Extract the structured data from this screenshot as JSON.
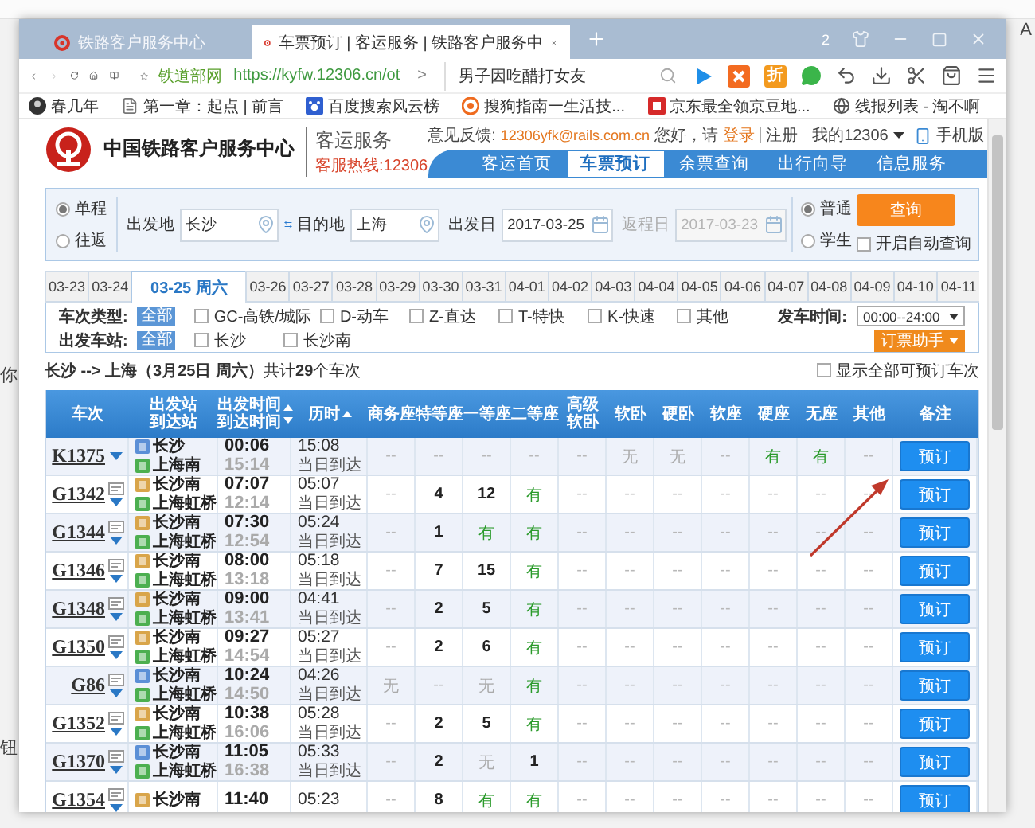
{
  "desktop": {
    "fragments": [
      "A",
      "你",
      "钮"
    ]
  },
  "browser": {
    "tabs": [
      {
        "title": "铁路客户服务中心",
        "selected": false
      },
      {
        "title": "车票预订 | 客运服务 | 铁路客户服务中",
        "selected": true
      }
    ],
    "badge": "2",
    "site_label": "铁道部网",
    "url": "https://kyfw.12306.cn/ot",
    "url_more": ">",
    "search_value": "男子因吃醋打女友",
    "discount_label": "折",
    "bookmarks": [
      {
        "label": "春几年",
        "kind": "avatar"
      },
      {
        "label": "第一章：起点 | 前言",
        "kind": "page"
      },
      {
        "label": "百度搜索风云榜",
        "kind": "paw"
      },
      {
        "label": "搜狗指南一生活技...",
        "kind": "sogou"
      },
      {
        "label": "京东最全领京豆地...",
        "kind": "jd"
      },
      {
        "label": "线报列表 - 淘不啊",
        "kind": "globe"
      }
    ]
  },
  "header": {
    "title": "中国铁路客户服务中心",
    "subtitle": "客运服务",
    "hotline": "客服热线:12306",
    "feedback_label": "意见反馈:",
    "feedback_email": "12306yfk@rails.com.cn",
    "greeting": "您好，请",
    "login": "登录",
    "register": "注册",
    "account": "我的12306",
    "mobile": "手机版",
    "nav": [
      {
        "label": "客运首页",
        "selected": false
      },
      {
        "label": "车票预订",
        "selected": true
      },
      {
        "label": "余票查询",
        "selected": false
      },
      {
        "label": "出行向导",
        "selected": false
      },
      {
        "label": "信息服务",
        "selected": false
      }
    ]
  },
  "search_form": {
    "trip_types": [
      {
        "label": "单程",
        "selected": true
      },
      {
        "label": "往返",
        "selected": false
      }
    ],
    "from": {
      "label": "出发地",
      "value": "长沙"
    },
    "to": {
      "label": "目的地",
      "value": "上海"
    },
    "depart_date": {
      "label": "出发日",
      "value": "2017-03-25",
      "disabled": false
    },
    "return_date": {
      "label": "返程日",
      "value": "2017-03-23",
      "disabled": true
    },
    "passenger_types": [
      {
        "label": "普通",
        "selected": true
      },
      {
        "label": "学生",
        "selected": false
      }
    ],
    "query_button": "查询",
    "auto_query": {
      "label": "开启自动查询",
      "checked": false
    }
  },
  "date_tabs": [
    {
      "label": "03-23",
      "selected": false
    },
    {
      "label": "03-24",
      "selected": false
    },
    {
      "label": "03-25 周六",
      "selected": true
    },
    {
      "label": "03-26",
      "selected": false
    },
    {
      "label": "03-27",
      "selected": false
    },
    {
      "label": "03-28",
      "selected": false
    },
    {
      "label": "03-29",
      "selected": false
    },
    {
      "label": "03-30",
      "selected": false
    },
    {
      "label": "03-31",
      "selected": false
    },
    {
      "label": "04-01",
      "selected": false
    },
    {
      "label": "04-02",
      "selected": false
    },
    {
      "label": "04-03",
      "selected": false
    },
    {
      "label": "04-04",
      "selected": false
    },
    {
      "label": "04-05",
      "selected": false
    },
    {
      "label": "04-06",
      "selected": false
    },
    {
      "label": "04-07",
      "selected": false
    },
    {
      "label": "04-08",
      "selected": false
    },
    {
      "label": "04-09",
      "selected": false
    },
    {
      "label": "04-10",
      "selected": false
    },
    {
      "label": "04-11",
      "selected": false
    }
  ],
  "filters": {
    "train_types": {
      "label": "车次类型:",
      "all": {
        "label": "全部",
        "selected": true
      },
      "options": [
        {
          "label": "GC-高铁/城际",
          "checked": false
        },
        {
          "label": "D-动车",
          "checked": false
        },
        {
          "label": "Z-直达",
          "checked": false
        },
        {
          "label": "T-特快",
          "checked": false
        },
        {
          "label": "K-快速",
          "checked": false
        },
        {
          "label": "其他",
          "checked": false
        }
      ]
    },
    "stations": {
      "label": "出发车站:",
      "all": {
        "label": "全部",
        "selected": true
      },
      "options": [
        {
          "label": "长沙",
          "checked": false
        },
        {
          "label": "长沙南",
          "checked": false
        }
      ]
    },
    "time_label": "发车时间:",
    "time_value": "00:00--24:00",
    "helper_button": "订票助手"
  },
  "summary": {
    "text": "**长沙 --> 上海（3月25日  周六）**共计**29**个车次",
    "show_all": {
      "label": "显示全部可预订车次",
      "checked": false
    }
  },
  "table": {
    "columns": [
      {
        "lines": [
          "车次"
        ]
      },
      {
        "lines": [
          "出发站",
          "到达站"
        ]
      },
      {
        "lines": [
          "出发时间",
          "到达时间"
        ],
        "sort_up": true,
        "sort_down": true
      },
      {
        "lines": [
          "历时"
        ],
        "sort_up": true
      },
      {
        "lines": [
          "商务座"
        ]
      },
      {
        "lines": [
          "特等座"
        ]
      },
      {
        "lines": [
          "一等座"
        ]
      },
      {
        "lines": [
          "二等座"
        ]
      },
      {
        "lines": [
          "高级",
          "软卧"
        ]
      },
      {
        "lines": [
          "软卧"
        ]
      },
      {
        "lines": [
          "硬卧"
        ]
      },
      {
        "lines": [
          "软座"
        ]
      },
      {
        "lines": [
          "硬座"
        ]
      },
      {
        "lines": [
          "无座"
        ]
      },
      {
        "lines": [
          "其他"
        ]
      },
      {
        "lines": [
          "备注"
        ]
      }
    ],
    "rows": [
      {
        "train": "K1375",
        "info_icon": false,
        "from": {
          "name": "长沙",
          "kind": "pass"
        },
        "to": {
          "name": "上海南",
          "kind": "terminal"
        },
        "depart": "00:06",
        "arrive": "15:14",
        "duration": "15:08",
        "arrival_day": "当日到达",
        "seats": [
          {
            "text": "--",
            "kind": "none"
          },
          {
            "text": "--",
            "kind": "none"
          },
          {
            "text": "--",
            "kind": "none"
          },
          {
            "text": "--",
            "kind": "none"
          },
          {
            "text": "--",
            "kind": "none"
          },
          {
            "text": "无",
            "kind": "sold"
          },
          {
            "text": "无",
            "kind": "sold"
          },
          {
            "text": "--",
            "kind": "none"
          },
          {
            "text": "有",
            "kind": "available"
          },
          {
            "text": "有",
            "kind": "available"
          },
          {
            "text": "--",
            "kind": "none"
          }
        ],
        "action": "预订"
      },
      {
        "train": "G1342",
        "info_icon": true,
        "from": {
          "name": "长沙南",
          "kind": "origin"
        },
        "to": {
          "name": "上海虹桥",
          "kind": "terminal"
        },
        "depart": "07:07",
        "arrive": "12:14",
        "duration": "05:07",
        "arrival_day": "当日到达",
        "seats": [
          {
            "text": "--",
            "kind": "none"
          },
          {
            "text": "4",
            "kind": "count"
          },
          {
            "text": "12",
            "kind": "count"
          },
          {
            "text": "有",
            "kind": "available"
          },
          {
            "text": "--",
            "kind": "none"
          },
          {
            "text": "--",
            "kind": "none"
          },
          {
            "text": "--",
            "kind": "none"
          },
          {
            "text": "--",
            "kind": "none"
          },
          {
            "text": "--",
            "kind": "none"
          },
          {
            "text": "--",
            "kind": "none"
          },
          {
            "text": "--",
            "kind": "none"
          }
        ],
        "action": "预订"
      },
      {
        "train": "G1344",
        "info_icon": true,
        "from": {
          "name": "长沙南",
          "kind": "origin"
        },
        "to": {
          "name": "上海虹桥",
          "kind": "terminal"
        },
        "depart": "07:30",
        "arrive": "12:54",
        "duration": "05:24",
        "arrival_day": "当日到达",
        "seats": [
          {
            "text": "--",
            "kind": "none"
          },
          {
            "text": "1",
            "kind": "count"
          },
          {
            "text": "有",
            "kind": "available"
          },
          {
            "text": "有",
            "kind": "available"
          },
          {
            "text": "--",
            "kind": "none"
          },
          {
            "text": "--",
            "kind": "none"
          },
          {
            "text": "--",
            "kind": "none"
          },
          {
            "text": "--",
            "kind": "none"
          },
          {
            "text": "--",
            "kind": "none"
          },
          {
            "text": "--",
            "kind": "none"
          },
          {
            "text": "--",
            "kind": "none"
          }
        ],
        "action": "预订"
      },
      {
        "train": "G1346",
        "info_icon": true,
        "from": {
          "name": "长沙南",
          "kind": "origin"
        },
        "to": {
          "name": "上海虹桥",
          "kind": "terminal"
        },
        "depart": "08:00",
        "arrive": "13:18",
        "duration": "05:18",
        "arrival_day": "当日到达",
        "seats": [
          {
            "text": "--",
            "kind": "none"
          },
          {
            "text": "7",
            "kind": "count"
          },
          {
            "text": "15",
            "kind": "count"
          },
          {
            "text": "有",
            "kind": "available"
          },
          {
            "text": "--",
            "kind": "none"
          },
          {
            "text": "--",
            "kind": "none"
          },
          {
            "text": "--",
            "kind": "none"
          },
          {
            "text": "--",
            "kind": "none"
          },
          {
            "text": "--",
            "kind": "none"
          },
          {
            "text": "--",
            "kind": "none"
          },
          {
            "text": "--",
            "kind": "none"
          }
        ],
        "action": "预订"
      },
      {
        "train": "G1348",
        "info_icon": true,
        "from": {
          "name": "长沙南",
          "kind": "origin"
        },
        "to": {
          "name": "上海虹桥",
          "kind": "terminal"
        },
        "depart": "09:00",
        "arrive": "13:41",
        "duration": "04:41",
        "arrival_day": "当日到达",
        "seats": [
          {
            "text": "--",
            "kind": "none"
          },
          {
            "text": "2",
            "kind": "count"
          },
          {
            "text": "5",
            "kind": "count"
          },
          {
            "text": "有",
            "kind": "available"
          },
          {
            "text": "--",
            "kind": "none"
          },
          {
            "text": "--",
            "kind": "none"
          },
          {
            "text": "--",
            "kind": "none"
          },
          {
            "text": "--",
            "kind": "none"
          },
          {
            "text": "--",
            "kind": "none"
          },
          {
            "text": "--",
            "kind": "none"
          },
          {
            "text": "--",
            "kind": "none"
          }
        ],
        "action": "预订"
      },
      {
        "train": "G1350",
        "info_icon": true,
        "from": {
          "name": "长沙南",
          "kind": "origin"
        },
        "to": {
          "name": "上海虹桥",
          "kind": "terminal"
        },
        "depart": "09:27",
        "arrive": "14:54",
        "duration": "05:27",
        "arrival_day": "当日到达",
        "seats": [
          {
            "text": "--",
            "kind": "none"
          },
          {
            "text": "2",
            "kind": "count"
          },
          {
            "text": "6",
            "kind": "count"
          },
          {
            "text": "有",
            "kind": "available"
          },
          {
            "text": "--",
            "kind": "none"
          },
          {
            "text": "--",
            "kind": "none"
          },
          {
            "text": "--",
            "kind": "none"
          },
          {
            "text": "--",
            "kind": "none"
          },
          {
            "text": "--",
            "kind": "none"
          },
          {
            "text": "--",
            "kind": "none"
          },
          {
            "text": "--",
            "kind": "none"
          }
        ],
        "action": "预订"
      },
      {
        "train": "G86",
        "info_icon": true,
        "from": {
          "name": "长沙南",
          "kind": "pass"
        },
        "to": {
          "name": "上海虹桥",
          "kind": "terminal"
        },
        "depart": "10:24",
        "arrive": "14:50",
        "duration": "04:26",
        "arrival_day": "当日到达",
        "seats": [
          {
            "text": "无",
            "kind": "sold"
          },
          {
            "text": "--",
            "kind": "none"
          },
          {
            "text": "无",
            "kind": "sold"
          },
          {
            "text": "有",
            "kind": "available"
          },
          {
            "text": "--",
            "kind": "none"
          },
          {
            "text": "--",
            "kind": "none"
          },
          {
            "text": "--",
            "kind": "none"
          },
          {
            "text": "--",
            "kind": "none"
          },
          {
            "text": "--",
            "kind": "none"
          },
          {
            "text": "--",
            "kind": "none"
          },
          {
            "text": "--",
            "kind": "none"
          }
        ],
        "action": "预订"
      },
      {
        "train": "G1352",
        "info_icon": true,
        "from": {
          "name": "长沙南",
          "kind": "origin"
        },
        "to": {
          "name": "上海虹桥",
          "kind": "terminal"
        },
        "depart": "10:38",
        "arrive": "16:06",
        "duration": "05:28",
        "arrival_day": "当日到达",
        "seats": [
          {
            "text": "--",
            "kind": "none"
          },
          {
            "text": "2",
            "kind": "count"
          },
          {
            "text": "5",
            "kind": "count"
          },
          {
            "text": "有",
            "kind": "available"
          },
          {
            "text": "--",
            "kind": "none"
          },
          {
            "text": "--",
            "kind": "none"
          },
          {
            "text": "--",
            "kind": "none"
          },
          {
            "text": "--",
            "kind": "none"
          },
          {
            "text": "--",
            "kind": "none"
          },
          {
            "text": "--",
            "kind": "none"
          },
          {
            "text": "--",
            "kind": "none"
          }
        ],
        "action": "预订"
      },
      {
        "train": "G1370",
        "info_icon": true,
        "from": {
          "name": "长沙南",
          "kind": "pass"
        },
        "to": {
          "name": "上海虹桥",
          "kind": "terminal"
        },
        "depart": "11:05",
        "arrive": "16:38",
        "duration": "05:33",
        "arrival_day": "当日到达",
        "seats": [
          {
            "text": "--",
            "kind": "none"
          },
          {
            "text": "2",
            "kind": "count"
          },
          {
            "text": "无",
            "kind": "sold"
          },
          {
            "text": "1",
            "kind": "count"
          },
          {
            "text": "--",
            "kind": "none"
          },
          {
            "text": "--",
            "kind": "none"
          },
          {
            "text": "--",
            "kind": "none"
          },
          {
            "text": "--",
            "kind": "none"
          },
          {
            "text": "--",
            "kind": "none"
          },
          {
            "text": "--",
            "kind": "none"
          },
          {
            "text": "--",
            "kind": "none"
          }
        ],
        "action": "预订"
      },
      {
        "train": "G1354",
        "info_icon": true,
        "from": {
          "name": "长沙南",
          "kind": "origin"
        },
        "depart": "11:40",
        "duration": "05:23",
        "seats": [
          {
            "text": "--",
            "kind": "none"
          },
          {
            "text": "8",
            "kind": "count"
          },
          {
            "text": "有",
            "kind": "available"
          },
          {
            "text": "有",
            "kind": "available"
          },
          {
            "text": "--",
            "kind": "none"
          },
          {
            "text": "--",
            "kind": "none"
          },
          {
            "text": "--",
            "kind": "none"
          },
          {
            "text": "--",
            "kind": "none"
          },
          {
            "text": "--",
            "kind": "none"
          },
          {
            "text": "--",
            "kind": "none"
          },
          {
            "text": "--",
            "kind": "none"
          }
        ],
        "action": "预订"
      }
    ]
  }
}
